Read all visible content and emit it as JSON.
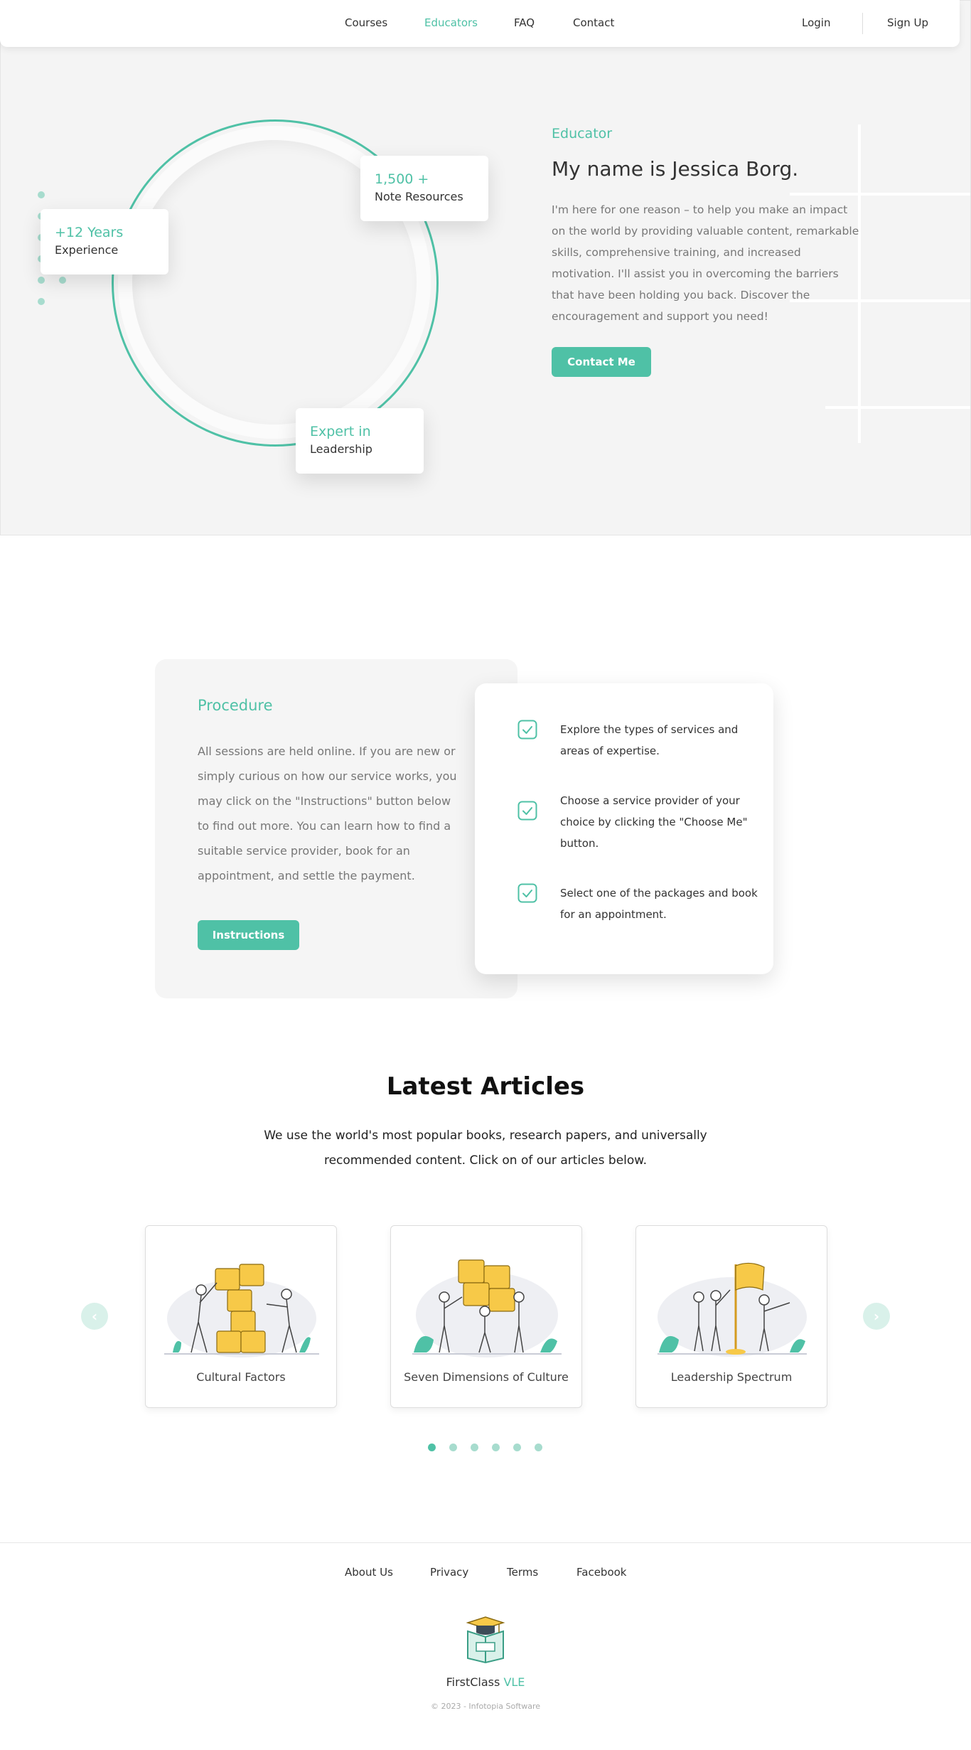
{
  "nav": {
    "links": [
      "Courses",
      "Educators",
      "FAQ",
      "Contact"
    ],
    "active_link": "Educators",
    "login": "Login",
    "signup": "Sign Up"
  },
  "hero": {
    "kicker": "Educator",
    "title": "My name is Jessica Borg.",
    "description": "I'm here for one reason – to help you make an impact on the world by providing valuable content, remarkable skills, comprehensive training, and increased motivation. I'll assist you in overcoming the barriers that have been holding you back. Discover the encouragement and support you need!",
    "cta": "Contact Me",
    "stats": [
      {
        "big": "+12 Years",
        "small": "Experience"
      },
      {
        "big": "1,500 +",
        "small": "Note Resources"
      },
      {
        "big": "Expert in",
        "small": "Leadership"
      }
    ]
  },
  "procedure": {
    "title": "Procedure",
    "description": "All sessions are held online. If you are new or simply curious on how our service works, you may click on the \"Instructions\" button below to find out more. You can learn how to find a suitable service provider, book for an appointment, and settle the payment.",
    "button": "Instructions",
    "steps": [
      "Explore the types of services and areas of expertise.",
      "Choose a service provider of your choice by clicking the \"Choose Me\" button.",
      "Select one of the packages and book for an appointment."
    ]
  },
  "articles": {
    "title": "Latest Articles",
    "subtitle": "We use the world's most popular books, research papers, and universally recommended content. Click on of our articles below.",
    "cards": [
      {
        "caption": "Cultural Factors",
        "image": "puzzle-team-illustration"
      },
      {
        "caption": "Seven Dimensions of Culture",
        "image": "puzzle-assembly-illustration"
      },
      {
        "caption": "Leadership Spectrum",
        "image": "flag-team-illustration"
      }
    ],
    "prev_icon": "chevron-left-icon",
    "next_icon": "chevron-right-icon",
    "pagination": {
      "pages": 6,
      "current": 1
    }
  },
  "footer": {
    "links": [
      "About Us",
      "Privacy",
      "Terms",
      "Facebook"
    ],
    "logo_icon": "graduation-book-icon",
    "brand_main": "FirstClass",
    "brand_accent": "VLE",
    "copyright": "© 2023 - Infotopia Software"
  },
  "colors": {
    "accent": "#4fc1a6",
    "accent_light": "#a7dcce",
    "hero_bg": "#f4f4f4",
    "illustration_yellow": "#f7c948"
  }
}
